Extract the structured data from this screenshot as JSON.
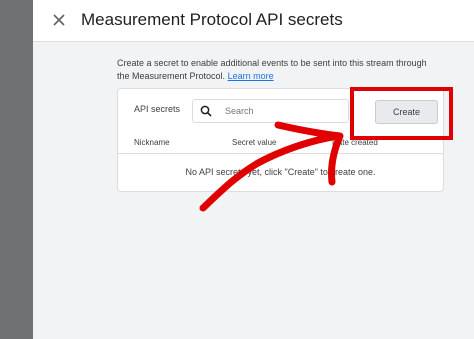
{
  "header": {
    "title": "Measurement Protocol API secrets",
    "close_icon": "close-icon"
  },
  "description": {
    "text": "Create a secret to enable additional events to be sent into this stream through the Measurement Protocol.",
    "link_text": "Learn more"
  },
  "secrets_card": {
    "label": "API secrets",
    "search": {
      "placeholder": "Search",
      "icon": "search-icon"
    },
    "create_button": "Create",
    "columns": [
      "Nickname",
      "Secret value",
      "Date created"
    ],
    "empty_message": "No API secrets yet, click \"Create\" to create one."
  },
  "annotations": {
    "highlight_color": "#e00000",
    "arrow_color": "#e00000"
  },
  "colors": {
    "link": "#1a73e8",
    "header_bg": "#ffffff",
    "page_bg": "#f1f3f4"
  }
}
